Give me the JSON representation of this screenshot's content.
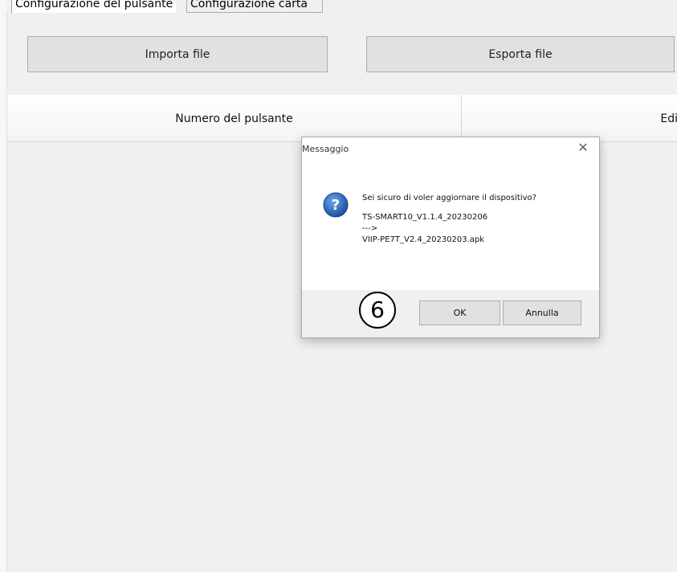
{
  "tabs": [
    {
      "label": "Configurazione del pulsante"
    },
    {
      "label": "Configurazione carta"
    }
  ],
  "toolbar": {
    "import_label": "Importa file",
    "export_label": "Esporta file"
  },
  "grid": {
    "columns": [
      "Numero del pulsante",
      "Edi"
    ]
  },
  "dialog": {
    "title": "Messaggio",
    "close_icon": "close-icon",
    "icon": "question-icon",
    "message": "Sei sicuro di voler aggiornare il dispositivo?",
    "from_version": "TS-SMART10_V1.1.4_20230206",
    "arrow": "--->",
    "to_version": "VIIP-PE7T_V2.4_20230203.apk",
    "ok_label": "OK",
    "cancel_label": "Annulla",
    "step_badge": "6"
  }
}
